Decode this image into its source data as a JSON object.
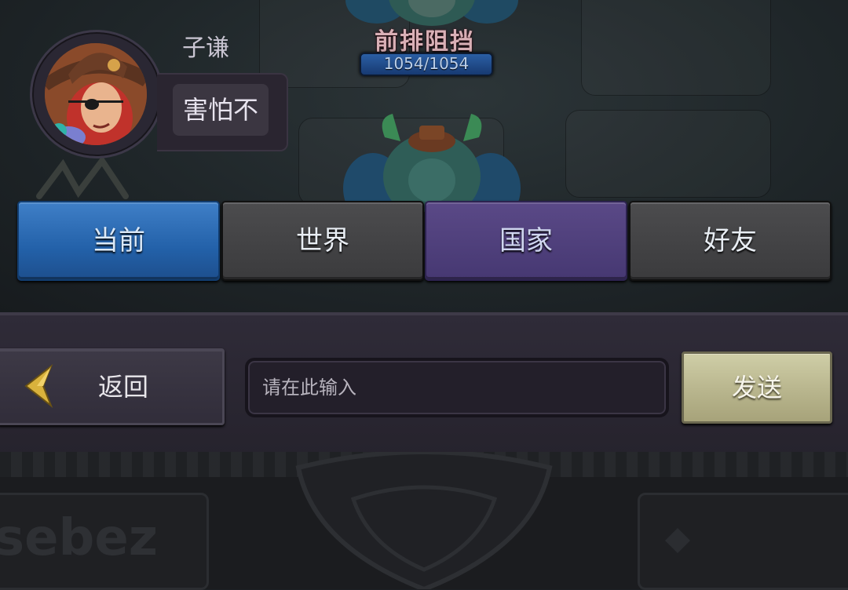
{
  "battle": {
    "unit_name": "前排阻挡",
    "hp_text": "1054/1054"
  },
  "chat": {
    "sender_name": "子谦",
    "message": "害怕不"
  },
  "tabs": [
    {
      "label": "当前",
      "active": true
    },
    {
      "label": "世界",
      "active": false
    },
    {
      "label": "国家",
      "active": false
    },
    {
      "label": "好友",
      "active": false
    }
  ],
  "input_bar": {
    "back_label": "返回",
    "placeholder": "请在此输入",
    "send_label": "发送"
  },
  "decor": {
    "left_banner_text": "sebez"
  },
  "colors": {
    "tab_current": "#2361a9",
    "tab_nation": "#463872",
    "tab_neutral": "#3b3b3d",
    "send_button": "#b8b58d",
    "panel": "#2a2631"
  }
}
